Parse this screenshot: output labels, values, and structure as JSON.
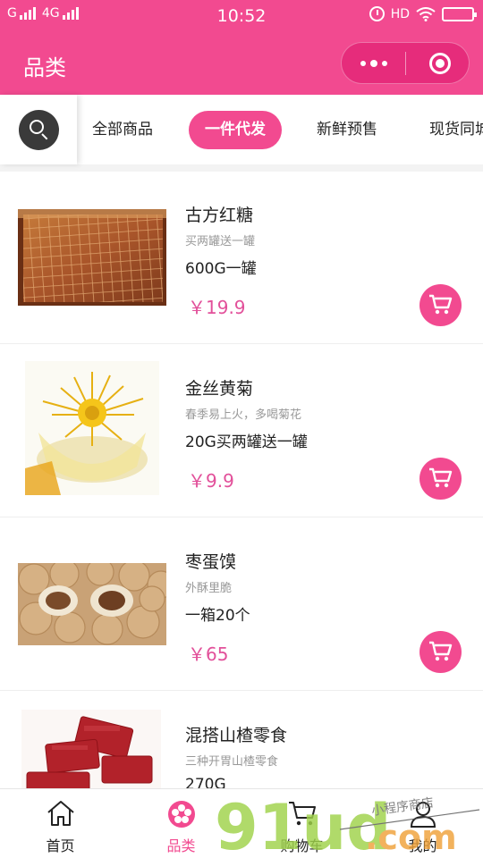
{
  "status_bar": {
    "carrier_left": "G",
    "network": "4G",
    "time": "10:52",
    "hd": "HD"
  },
  "header": {
    "title": "品类",
    "more_icon": "more-dots-icon",
    "close_icon": "target-close-icon"
  },
  "tabs": {
    "search_icon": "search-icon",
    "items": [
      {
        "label": "全部商品"
      },
      {
        "label": "一件代发"
      },
      {
        "label": "新鲜预售"
      },
      {
        "label": "现货同城"
      }
    ],
    "active_index": 1
  },
  "products": [
    {
      "name": "古方红糖",
      "subtitle": "买两罐送一罐",
      "spec": "600G一罐",
      "price": "￥19.9"
    },
    {
      "name": "金丝黄菊",
      "subtitle": "春季易上火，多喝菊花",
      "spec": "20G买两罐送一罐",
      "price": "￥9.9"
    },
    {
      "name": "枣蛋馍",
      "subtitle": "外酥里脆",
      "spec": "一箱20个",
      "price": "￥65"
    },
    {
      "name": "混搭山楂零食",
      "subtitle": "三种开胃山楂零食",
      "spec": "270G",
      "price": ""
    }
  ],
  "bottom_nav": {
    "items": [
      {
        "label": "首页",
        "icon": "home-icon"
      },
      {
        "label": "品类",
        "icon": "flower-icon"
      },
      {
        "label": "购物车",
        "icon": "cart-icon"
      },
      {
        "label": "我的",
        "icon": "user-icon"
      }
    ],
    "active_index": 1
  },
  "watermark": {
    "logo": "91ud",
    "suffix": ".com",
    "tagline": "小程序商店"
  },
  "colors": {
    "accent": "#f24a90",
    "price": "#e2509a",
    "dark": "#3a3a3a"
  }
}
